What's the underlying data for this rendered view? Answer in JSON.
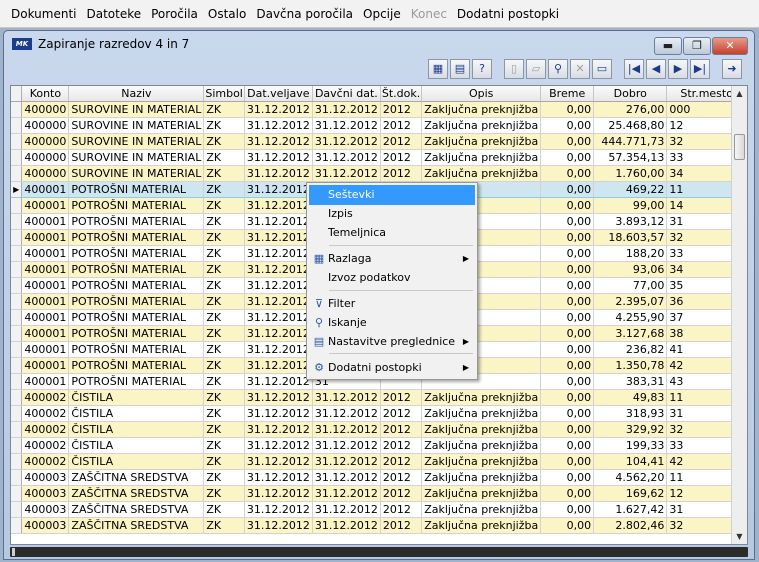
{
  "menubar": {
    "items": [
      {
        "label": "Dokumenti"
      },
      {
        "label": "Datoteke"
      },
      {
        "label": "Poročila"
      },
      {
        "label": "Ostalo"
      },
      {
        "label": "Davčna poročila"
      },
      {
        "label": "Opcije"
      },
      {
        "label": "Konec"
      },
      {
        "label": "Dodatni postopki"
      }
    ]
  },
  "window": {
    "title": "Zapiranje razredov 4 in 7",
    "logo": "MK",
    "min_label": "▬",
    "max_label": "❐",
    "close_label": "✕"
  },
  "toolbar": {
    "icons": [
      "calendar-icon",
      "table-icon",
      "help-icon",
      "new-doc-icon",
      "open-folder-icon",
      "search-icon",
      "delete-icon",
      "print-icon",
      "first-record-icon",
      "previous-record-icon",
      "next-record-icon",
      "last-record-icon",
      "exit-icon"
    ],
    "glyphs": [
      "▦",
      "▤",
      "?",
      "▯",
      "▱",
      "⚲",
      "✕",
      "▭",
      "|◀",
      "◀",
      "▶",
      "▶|",
      "➜"
    ]
  },
  "grid": {
    "columns": [
      "Konto",
      "Naziv",
      "Simbol",
      "Dat.veljave",
      "Davčni dat.",
      "Št.dok.",
      "Opis",
      "Breme",
      "Dobro",
      "Str.mesto"
    ],
    "selected_indicator": "▶",
    "rows": [
      [
        "400000",
        "SUROVINE IN MATERIAL",
        "ZK",
        "31.12.2012",
        "31.12.2012",
        "2012",
        "Zaključna preknjižba",
        "0,00",
        "276,00",
        "000"
      ],
      [
        "400000",
        "SUROVINE IN MATERIAL",
        "ZK",
        "31.12.2012",
        "31.12.2012",
        "2012",
        "Zaključna preknjižba",
        "0,00",
        "25.468,80",
        "12"
      ],
      [
        "400000",
        "SUROVINE IN MATERIAL",
        "ZK",
        "31.12.2012",
        "31.12.2012",
        "2012",
        "Zaključna preknjižba",
        "0,00",
        "444.771,73",
        "32"
      ],
      [
        "400000",
        "SUROVINE IN MATERIAL",
        "ZK",
        "31.12.2012",
        "31.12.2012",
        "2012",
        "Zaključna preknjižba",
        "0,00",
        "57.354,13",
        "33"
      ],
      [
        "400000",
        "SUROVINE IN MATERIAL",
        "ZK",
        "31.12.2012",
        "31.12.2012",
        "2012",
        "Zaključna preknjižba",
        "0,00",
        "1.760,00",
        "34"
      ],
      [
        "400001",
        "POTROŠNI MATERIAL",
        "ZK",
        "31.12.2012",
        "31",
        "",
        "",
        "0,00",
        "469,22",
        "11"
      ],
      [
        "400001",
        "POTROŠNI MATERIAL",
        "ZK",
        "31.12.2012",
        "31",
        "",
        "",
        "0,00",
        "99,00",
        "14"
      ],
      [
        "400001",
        "POTROŠNI MATERIAL",
        "ZK",
        "31.12.2012",
        "31",
        "",
        "",
        "0,00",
        "3.893,12",
        "31"
      ],
      [
        "400001",
        "POTROŠNI MATERIAL",
        "ZK",
        "31.12.2012",
        "31",
        "",
        "",
        "0,00",
        "18.603,57",
        "32"
      ],
      [
        "400001",
        "POTROŠNI MATERIAL",
        "ZK",
        "31.12.2012",
        "31",
        "",
        "",
        "0,00",
        "188,20",
        "33"
      ],
      [
        "400001",
        "POTROŠNI MATERIAL",
        "ZK",
        "31.12.2012",
        "31",
        "",
        "",
        "0,00",
        "93,06",
        "34"
      ],
      [
        "400001",
        "POTROŠNI MATERIAL",
        "ZK",
        "31.12.2012",
        "31",
        "",
        "",
        "0,00",
        "77,00",
        "35"
      ],
      [
        "400001",
        "POTROŠNI MATERIAL",
        "ZK",
        "31.12.2012",
        "31",
        "",
        "",
        "0,00",
        "2.395,07",
        "36"
      ],
      [
        "400001",
        "POTROŠNI MATERIAL",
        "ZK",
        "31.12.2012",
        "31",
        "",
        "",
        "0,00",
        "4.255,90",
        "37"
      ],
      [
        "400001",
        "POTROŠNI MATERIAL",
        "ZK",
        "31.12.2012",
        "31",
        "",
        "",
        "0,00",
        "3.127,68",
        "38"
      ],
      [
        "400001",
        "POTROŠNI MATERIAL",
        "ZK",
        "31.12.2012",
        "31",
        "",
        "",
        "0,00",
        "236,82",
        "41"
      ],
      [
        "400001",
        "POTROŠNI MATERIAL",
        "ZK",
        "31.12.2012",
        "31",
        "",
        "",
        "0,00",
        "1.350,78",
        "42"
      ],
      [
        "400001",
        "POTROŠNI MATERIAL",
        "ZK",
        "31.12.2012",
        "31",
        "",
        "",
        "0,00",
        "383,31",
        "43"
      ],
      [
        "400002",
        "ČISTILA",
        "ZK",
        "31.12.2012",
        "31.12.2012",
        "2012",
        "Zaključna preknjižba",
        "0,00",
        "49,83",
        "11"
      ],
      [
        "400002",
        "ČISTILA",
        "ZK",
        "31.12.2012",
        "31.12.2012",
        "2012",
        "Zaključna preknjižba",
        "0,00",
        "318,93",
        "31"
      ],
      [
        "400002",
        "ČISTILA",
        "ZK",
        "31.12.2012",
        "31.12.2012",
        "2012",
        "Zaključna preknjižba",
        "0,00",
        "329,92",
        "32"
      ],
      [
        "400002",
        "ČISTILA",
        "ZK",
        "31.12.2012",
        "31.12.2012",
        "2012",
        "Zaključna preknjižba",
        "0,00",
        "199,33",
        "33"
      ],
      [
        "400002",
        "ČISTILA",
        "ZK",
        "31.12.2012",
        "31.12.2012",
        "2012",
        "Zaključna preknjižba",
        "0,00",
        "104,41",
        "42"
      ],
      [
        "400003",
        "ZAŠČITNA SREDSTVA",
        "ZK",
        "31.12.2012",
        "31.12.2012",
        "2012",
        "Zaključna preknjižba",
        "0,00",
        "4.562,20",
        "11"
      ],
      [
        "400003",
        "ZAŠČITNA SREDSTVA",
        "ZK",
        "31.12.2012",
        "31.12.2012",
        "2012",
        "Zaključna preknjižba",
        "0,00",
        "169,62",
        "12"
      ],
      [
        "400003",
        "ZAŠČITNA SREDSTVA",
        "ZK",
        "31.12.2012",
        "31.12.2012",
        "2012",
        "Zaključna preknjižba",
        "0,00",
        "1.627,42",
        "31"
      ],
      [
        "400003",
        "ZAŠČITNA SREDSTVA",
        "ZK",
        "31.12.2012",
        "31.12.2012",
        "2012",
        "Zaključna preknjižba",
        "0,00",
        "2.802,46",
        "32"
      ]
    ]
  },
  "context_menu": {
    "items": [
      {
        "label": "Seštevki",
        "highlighted": true
      },
      {
        "label": "Izpis"
      },
      {
        "label": "Temeljnica"
      },
      {
        "label": "Razlaga",
        "icon": "calendar-icon",
        "submenu": true
      },
      {
        "label": "Izvoz podatkov"
      },
      {
        "label": "Filter",
        "icon": "filter-icon"
      },
      {
        "label": "Iskanje",
        "icon": "search-icon"
      },
      {
        "label": "Nastavitve preglednice",
        "icon": "table-settings-icon",
        "submenu": true
      },
      {
        "label": "Dodatni postopki",
        "icon": "gears-icon",
        "submenu": true
      }
    ],
    "icon_glyphs": {
      "calendar-icon": "▦",
      "filter-icon": "⊽",
      "search-icon": "⚲",
      "table-settings-icon": "▤",
      "gears-icon": "⚙"
    },
    "submenu_arrow": "▶"
  },
  "scrollbar": {
    "up": "▲",
    "down": "▼"
  }
}
